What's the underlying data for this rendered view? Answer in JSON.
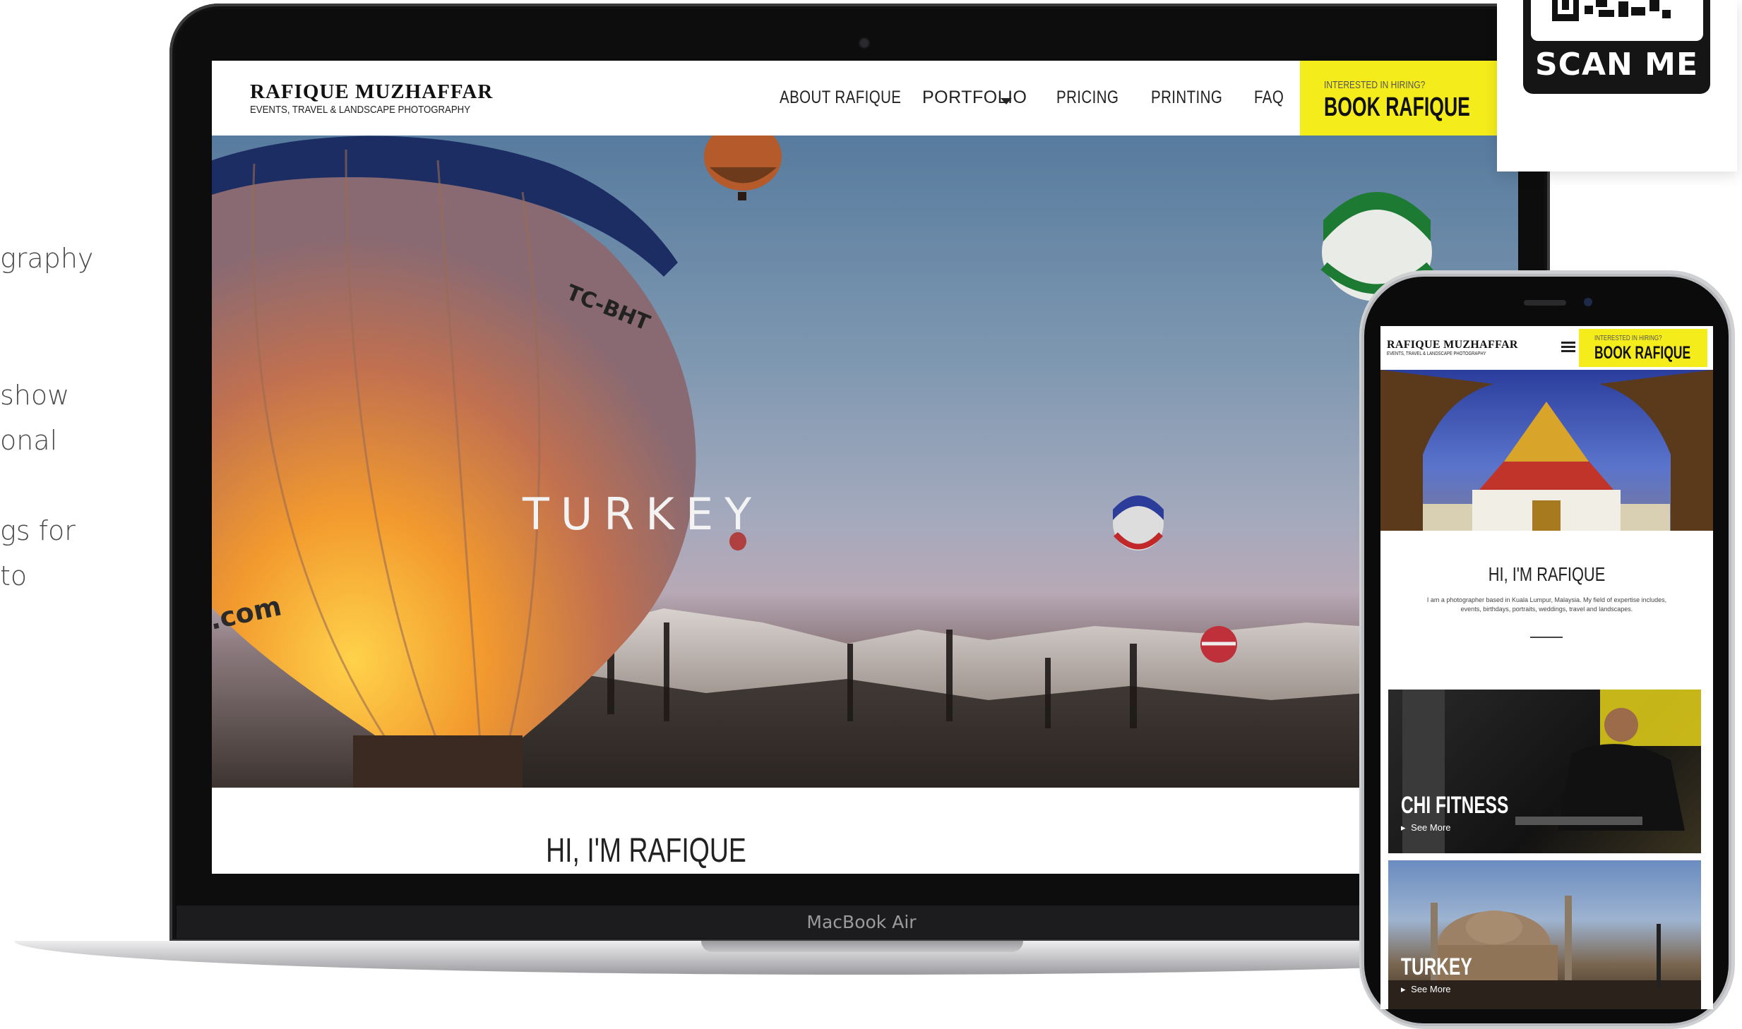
{
  "side_text": {
    "line1": "graphy",
    "line2": "show",
    "line3": "onal",
    "line4": "gs for",
    "line5": "to"
  },
  "laptop": {
    "model_label": "MacBook Air",
    "site": {
      "logo": {
        "name": "RAFIQUE MUZHAFFAR",
        "tagline": "EVENTS, TRAVEL & LANDSCAPE PHOTOGRAPHY"
      },
      "nav": [
        {
          "label": "ABOUT RAFIQUE"
        },
        {
          "label": "PORTFOLIO"
        },
        {
          "label": "PRICING"
        },
        {
          "label": "PRINTING"
        },
        {
          "label": "FAQ"
        }
      ],
      "cta": {
        "small": "INTERESTED IN HIRING?",
        "big": "BOOK RAFIQUE"
      },
      "hero_title": "TURKEY",
      "balloon_marking": "TC-BHT",
      "balloon_text": ".com",
      "intro_heading": "HI, I'M RAFIQUE"
    }
  },
  "phone": {
    "site": {
      "logo": {
        "name": "RAFIQUE MUZHAFFAR",
        "tagline": "EVENTS, TRAVEL & LANDSCAPE PHOTOGRAPHY"
      },
      "menu_icon": "hamburger-icon",
      "cta": {
        "small": "INTERESTED IN HIRING?",
        "big": "BOOK RAFIQUE"
      },
      "intro_heading": "HI, I'M RAFIQUE",
      "intro_text": "I am a photographer based in Kuala Lumpur, Malaysia. My field of expertise includes, events, birthdays, portraits, weddings, travel and landscapes.",
      "cards": [
        {
          "title": "CHI FITNESS",
          "link": "See More"
        },
        {
          "title": "TURKEY",
          "link": "See More"
        }
      ]
    }
  },
  "qr": {
    "label": "SCAN ME"
  },
  "colors": {
    "accent_yellow": "#f5ec1b",
    "text_dark": "#222222",
    "device_black": "#0b0b0c"
  }
}
